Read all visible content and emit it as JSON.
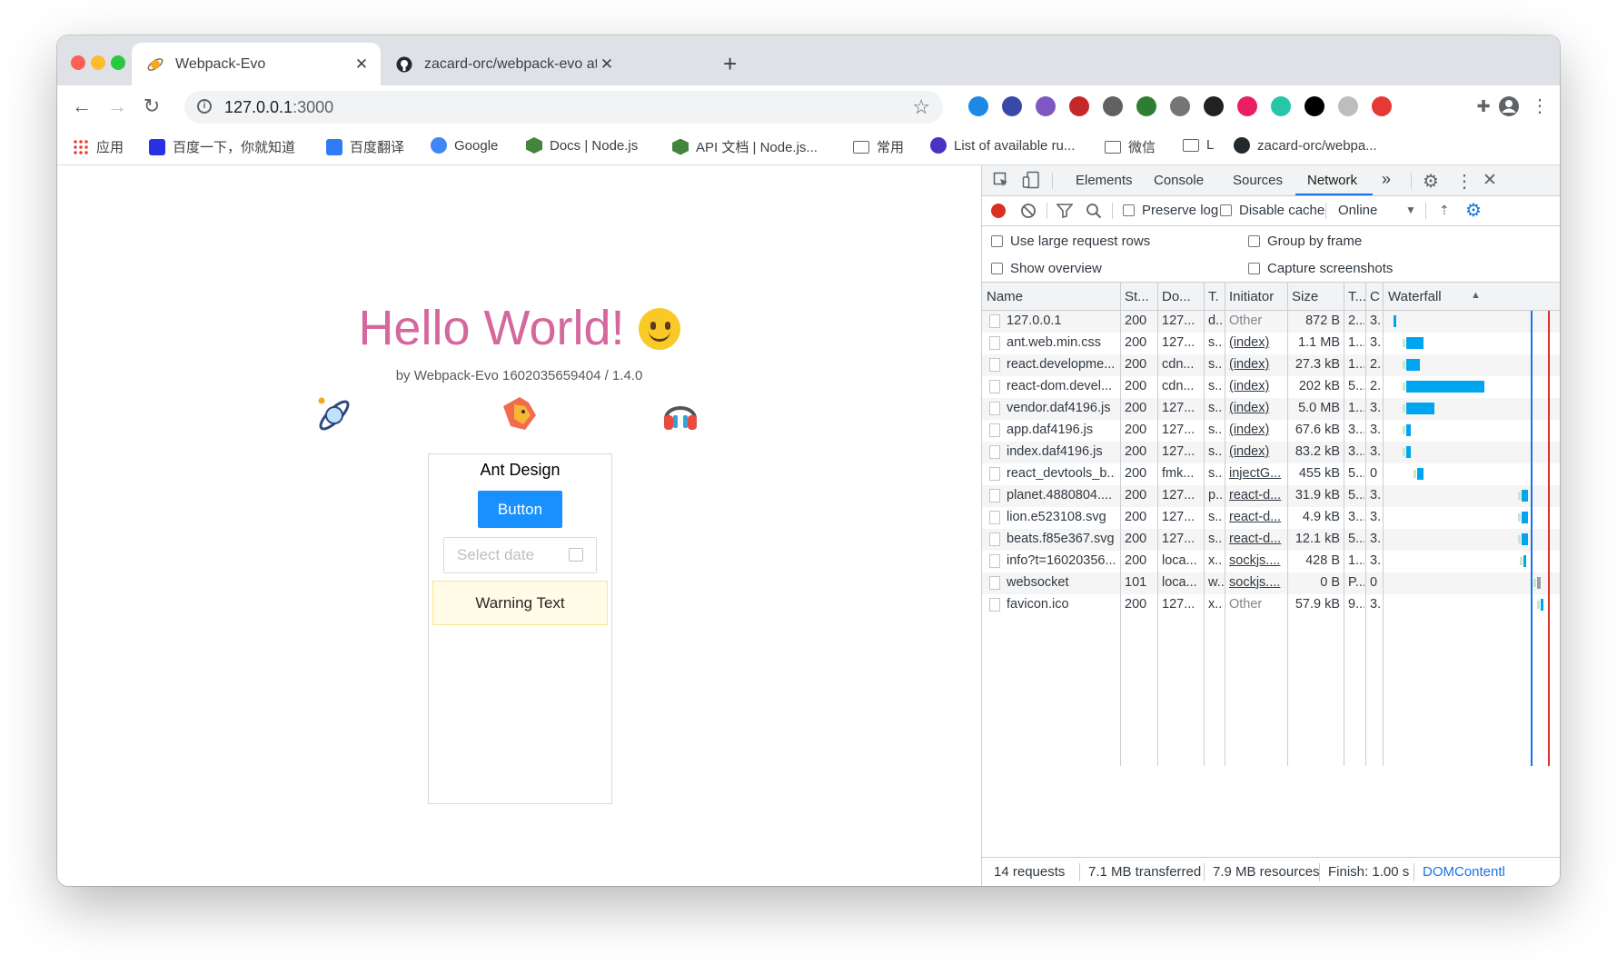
{
  "tabs": [
    {
      "title": "Webpack-Evo",
      "active": true,
      "icon": "planet-icon"
    },
    {
      "title": "zacard-orc/webpack-evo at de",
      "active": false,
      "icon": "github-icon"
    }
  ],
  "toolbar": {
    "url_host": "127.0.0.1",
    "url_port": ":3000"
  },
  "extensions": [
    {
      "name": "earth-blue-icon",
      "color": "#1e88e5"
    },
    {
      "name": "globe-icon",
      "color": "#3949ab"
    },
    {
      "name": "wm-icon",
      "color": "#7e57c2"
    },
    {
      "name": "puzzle-red-icon",
      "color": "#c62828"
    },
    {
      "name": "vue-v-icon",
      "color": "#616161"
    },
    {
      "name": "green-c-icon",
      "color": "#2e7d32"
    },
    {
      "name": "brackets-icon",
      "color": "#757575"
    },
    {
      "name": "cb-icon",
      "color": "#212121"
    },
    {
      "name": "heart-icon",
      "color": "#e91e63"
    },
    {
      "name": "grammar-icon",
      "color": "#26c6a6"
    },
    {
      "name": "jb-icon",
      "color": "#000000"
    },
    {
      "name": "disabled-icon",
      "color": "#bdbdbd"
    },
    {
      "name": "tree-icon",
      "color": "#e53935"
    }
  ],
  "bookmarks": [
    {
      "label": "应用",
      "icon": "apps-grid-icon"
    },
    {
      "label": "百度一下，你就知道",
      "icon": "baidu-icon"
    },
    {
      "label": "百度翻译",
      "icon": "translate-icon"
    },
    {
      "label": "Google",
      "icon": "google-icon"
    },
    {
      "label": "Docs | Node.js",
      "icon": "nodejs-icon"
    },
    {
      "label": "API 文档 | Node.js...",
      "icon": "nodejs-icon"
    },
    {
      "label": "常用",
      "icon": "folder-icon"
    },
    {
      "label": "List of available ru...",
      "icon": "eslint-icon"
    },
    {
      "label": "微信",
      "icon": "folder-icon"
    },
    {
      "label": "L",
      "icon": "folder-icon"
    },
    {
      "label": "zacard-orc/webpa...",
      "icon": "github-icon"
    }
  ],
  "page": {
    "heading": "Hello World!",
    "byline": "by Webpack-Evo 1602035659404 / 1.4.0",
    "ant_title": "Ant Design",
    "button_label": "Button",
    "date_placeholder": "Select date",
    "warning_text": "Warning Text"
  },
  "devtools": {
    "tabs": [
      "Elements",
      "Console",
      "Sources",
      "Network"
    ],
    "active_tab": "Network",
    "more": "»",
    "preserve_log": "Preserve log",
    "disable_cache": "Disable cache",
    "throttle": "Online",
    "options": {
      "large_rows": "Use large request rows",
      "group_frame": "Group by frame",
      "show_overview": "Show overview",
      "capture_screens": "Capture screenshots"
    },
    "columns": {
      "name": "Name",
      "status": "St...",
      "domain": "Do...",
      "type": "T.",
      "initiator": "Initiator",
      "size": "Size",
      "time": "T...",
      "conn": "C",
      "waterfall": "Waterfall"
    },
    "rows": [
      {
        "name": "127.0.0.1",
        "status": "200",
        "domain": "127...",
        "type": "d..",
        "initiator": "Other",
        "init_link": false,
        "size": "872 B",
        "time": "2...",
        "conn": "3.",
        "wf_start": 0.04,
        "wf_len": 0.01
      },
      {
        "name": "ant.web.min.css",
        "status": "200",
        "domain": "127...",
        "type": "s..",
        "initiator": "(index)",
        "init_link": true,
        "size": "1.1 MB",
        "time": "1...",
        "conn": "3.",
        "wf_start": 0.12,
        "wf_len": 0.11
      },
      {
        "name": "react.developme...",
        "status": "200",
        "domain": "cdn...",
        "type": "s..",
        "initiator": "(index)",
        "init_link": true,
        "size": "27.3 kB",
        "time": "1...",
        "conn": "2.",
        "wf_start": 0.12,
        "wf_len": 0.09
      },
      {
        "name": "react-dom.devel...",
        "status": "200",
        "domain": "cdn...",
        "type": "s..",
        "initiator": "(index)",
        "init_link": true,
        "size": "202 kB",
        "time": "5...",
        "conn": "2.",
        "wf_start": 0.12,
        "wf_len": 0.5
      },
      {
        "name": "vendor.daf4196.js",
        "status": "200",
        "domain": "127...",
        "type": "s..",
        "initiator": "(index)",
        "init_link": true,
        "size": "5.0 MB",
        "time": "1...",
        "conn": "3.",
        "wf_start": 0.12,
        "wf_len": 0.18
      },
      {
        "name": "app.daf4196.js",
        "status": "200",
        "domain": "127...",
        "type": "s..",
        "initiator": "(index)",
        "init_link": true,
        "size": "67.6 kB",
        "time": "3...",
        "conn": "3.",
        "wf_start": 0.12,
        "wf_len": 0.03
      },
      {
        "name": "index.daf4196.js",
        "status": "200",
        "domain": "127...",
        "type": "s..",
        "initiator": "(index)",
        "init_link": true,
        "size": "83.2 kB",
        "time": "3...",
        "conn": "3.",
        "wf_start": 0.12,
        "wf_len": 0.03
      },
      {
        "name": "react_devtools_b...",
        "status": "200",
        "domain": "fmk...",
        "type": "s..",
        "initiator": "injectG...",
        "init_link": true,
        "size": "455 kB",
        "time": "5...",
        "conn": "0",
        "wf_start": 0.19,
        "wf_len": 0.04
      },
      {
        "name": "planet.4880804....",
        "status": "200",
        "domain": "127...",
        "type": "p..",
        "initiator": "react-d...",
        "init_link": true,
        "size": "31.9 kB",
        "time": "5...",
        "conn": "3.",
        "wf_start": 0.86,
        "wf_len": 0.04
      },
      {
        "name": "lion.e523108.svg",
        "status": "200",
        "domain": "127...",
        "type": "s..",
        "initiator": "react-d...",
        "init_link": true,
        "size": "4.9 kB",
        "time": "3...",
        "conn": "3.",
        "wf_start": 0.86,
        "wf_len": 0.04
      },
      {
        "name": "beats.f85e367.svg",
        "status": "200",
        "domain": "127...",
        "type": "s..",
        "initiator": "react-d...",
        "init_link": true,
        "size": "12.1 kB",
        "time": "5...",
        "conn": "3.",
        "wf_start": 0.86,
        "wf_len": 0.04
      },
      {
        "name": "info?t=16020356...",
        "status": "200",
        "domain": "loca...",
        "type": "x..",
        "initiator": "sockjs....",
        "init_link": true,
        "size": "428 B",
        "time": "1...",
        "conn": "3.",
        "wf_start": 0.87,
        "wf_len": 0.015
      },
      {
        "name": "websocket",
        "status": "101",
        "domain": "loca...",
        "type": "w..",
        "initiator": "sockjs....",
        "init_link": true,
        "size": "0 B",
        "time": "P...",
        "conn": "0",
        "wf_start": 0.96,
        "wf_len": 0.02
      },
      {
        "name": "favicon.ico",
        "status": "200",
        "domain": "127...",
        "type": "x..",
        "initiator": "Other",
        "init_link": false,
        "size": "57.9 kB",
        "time": "9...",
        "conn": "3.",
        "wf_start": 0.98,
        "wf_len": 0.015
      }
    ],
    "status": {
      "requests": "14 requests",
      "transferred": "7.1 MB transferred",
      "resources": "7.9 MB resources",
      "finish": "Finish: 1.00 s",
      "domcontent": "DOMContentl"
    },
    "colors": {
      "accent": "#1a73e8",
      "record": "#d93025",
      "waterfall": "#00a5f2"
    }
  }
}
